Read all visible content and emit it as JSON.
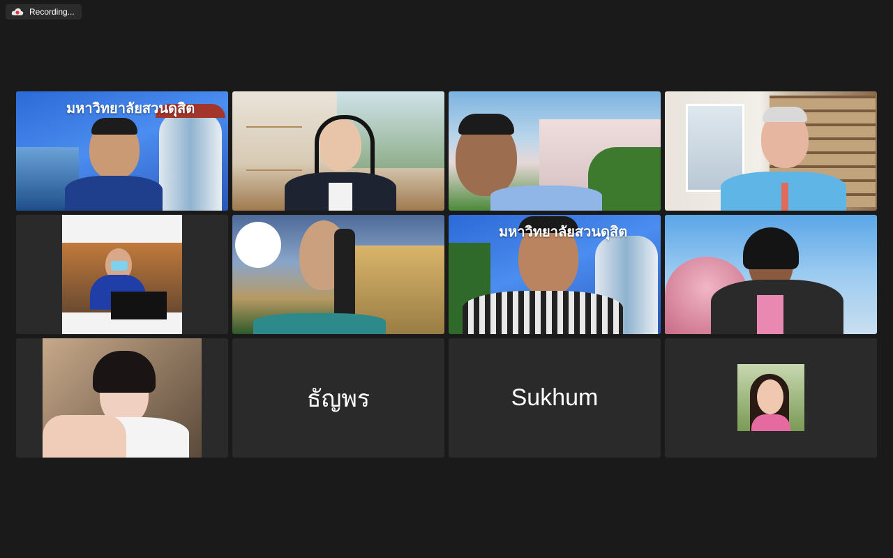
{
  "recording": {
    "label": "Recording...",
    "icon": "cloud-record-icon"
  },
  "gallery": {
    "tiles": [
      {
        "type": "video",
        "active": true,
        "banner": "มหาวิทยาลัยสวนดุสิต"
      },
      {
        "type": "video",
        "active": false
      },
      {
        "type": "video",
        "active": false
      },
      {
        "type": "video",
        "active": false
      },
      {
        "type": "video",
        "active": false
      },
      {
        "type": "video",
        "active": false
      },
      {
        "type": "video",
        "active": false,
        "banner": "มหาวิทยาลัยสวนดุสิต"
      },
      {
        "type": "video",
        "active": false
      },
      {
        "type": "video",
        "active": false
      },
      {
        "type": "name",
        "name": "ธัญพร"
      },
      {
        "type": "name",
        "name": "Sukhum"
      },
      {
        "type": "avatar"
      }
    ]
  },
  "colors": {
    "active_speaker": "#3ee043",
    "background": "#1a1a1a",
    "tile": "#2a2a2a"
  }
}
